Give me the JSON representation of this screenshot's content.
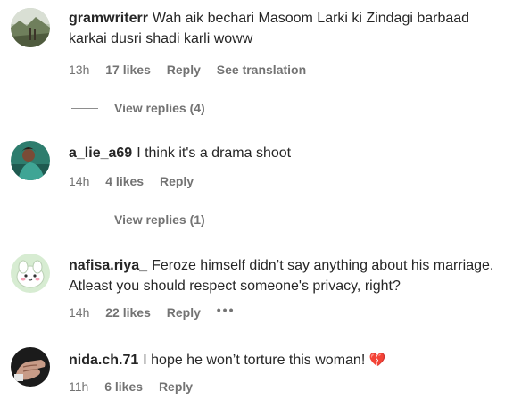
{
  "comments": [
    {
      "username": "gramwriterr",
      "text": "Wah aik bechari Masoom Larki ki Zindagi barbaad karkai dusri shadi karli woww",
      "time": "13h",
      "likes": "17 likes",
      "reply": "Reply",
      "translate": "See translation",
      "view_replies": "View replies (4)",
      "avatar_icon": "landscape-photo-avatar"
    },
    {
      "username": "a_lie_a69",
      "text": "I think it's a drama shoot",
      "time": "14h",
      "likes": "4 likes",
      "reply": "Reply",
      "view_replies": "View replies (1)",
      "avatar_icon": "person-photo-avatar"
    },
    {
      "username": "nafisa.riya_",
      "text": "Feroze himself didn’t say anything about his marriage. Atleast you should respect someone's privacy, right?",
      "time": "14h",
      "likes": "22 likes",
      "reply": "Reply",
      "more": "•••",
      "avatar_icon": "cartoon-avatar"
    },
    {
      "username": "nida.ch.71",
      "text": "I hope he won’t torture this woman!",
      "emoji": "💔",
      "time": "11h",
      "likes": "6 likes",
      "reply": "Reply",
      "avatar_icon": "hand-photo-avatar"
    }
  ],
  "colors": {
    "text": "#262626",
    "secondary": "#737373",
    "heart": "#d1305a"
  }
}
